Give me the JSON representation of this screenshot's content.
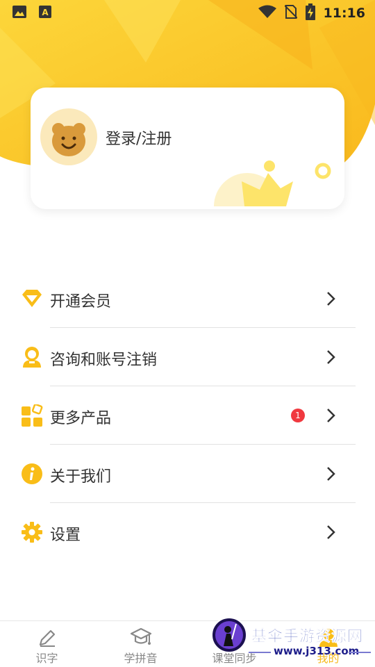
{
  "status_bar": {
    "time": "11:16",
    "left_icons": [
      "image-icon",
      "font-a-icon"
    ],
    "right_icons": [
      "wifi-icon",
      "no-sim-icon",
      "battery-charging-icon"
    ]
  },
  "user_card": {
    "login_label": "登录/注册",
    "avatar_icon": "bear-icon",
    "decoration_icon": "crown-icon"
  },
  "menu": [
    {
      "label": "开通会员",
      "icon": "diamond-icon"
    },
    {
      "label": "咨询和账号注销",
      "icon": "support-agent-icon"
    },
    {
      "label": "更多产品",
      "icon": "apps-icon",
      "badge": "1"
    },
    {
      "label": "关于我们",
      "icon": "info-icon"
    },
    {
      "label": "设置",
      "icon": "gear-icon"
    }
  ],
  "bottom_nav": [
    {
      "label": "识字",
      "icon": "pencil-icon",
      "active": false
    },
    {
      "label": "学拼音",
      "icon": "graduation-cap-icon",
      "active": false
    },
    {
      "label": "课堂同步",
      "icon": "classroom-icon",
      "active": false
    },
    {
      "label": "我的",
      "icon": "profile-icon",
      "active": true
    }
  ],
  "watermark": {
    "title": "基伞手游资源网",
    "url": "www.j313.com"
  },
  "colors": {
    "brand_yellow": "#fcc419",
    "accent_orange": "#f6a821",
    "badge_red": "#f0393f",
    "text_primary": "#333333",
    "text_muted": "#888888"
  }
}
